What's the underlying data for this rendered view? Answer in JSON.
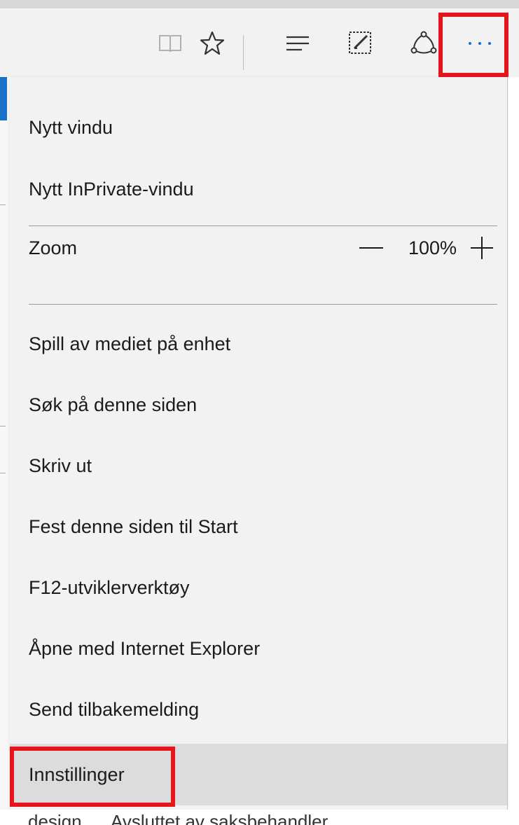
{
  "toolbar": {
    "icons": [
      "reading-view-icon",
      "favorites-star-icon",
      "hub-icon",
      "web-note-icon",
      "share-icon",
      "more-actions-icon"
    ]
  },
  "menu": {
    "new_window": "Nytt vindu",
    "new_inprivate_window": "Nytt InPrivate-vindu",
    "zoom_label": "Zoom",
    "zoom_value": "100%",
    "cast_media": "Spill av mediet på enhet",
    "find_on_page": "Søk på denne siden",
    "print": "Skriv ut",
    "pin_to_start": "Fest denne siden til Start",
    "developer_tools": "F12-utviklerverktøy",
    "open_with_ie": "Åpne med Internet Explorer",
    "send_feedback": "Send tilbakemelding",
    "settings": "Innstillinger"
  },
  "background_page": {
    "cell_1": "design,",
    "cell_2": "Avsluttet av saksbehandler"
  },
  "colors": {
    "highlight_border": "#e8141b",
    "accent_blue": "#1a6fc9",
    "menu_background": "#f2f2f2",
    "selected_item": "#dcdcdc"
  }
}
